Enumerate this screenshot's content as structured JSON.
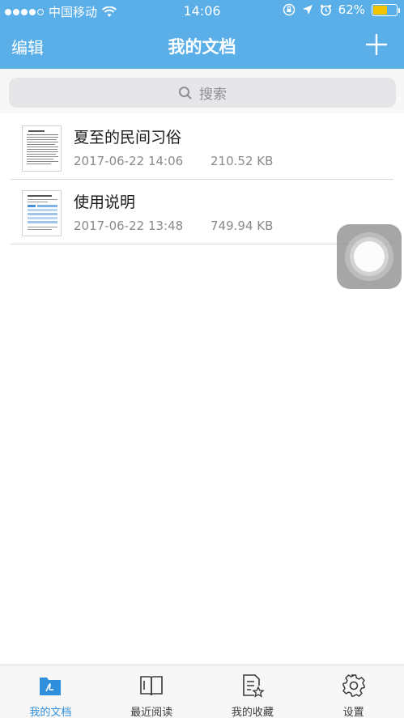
{
  "status_bar": {
    "carrier": "中国移动",
    "time": "14:06",
    "battery": "62%",
    "battery_level": 0.62,
    "signal_bars": 4
  },
  "nav": {
    "edit_label": "编辑",
    "title": "我的文档",
    "add_icon": "plus-icon"
  },
  "search": {
    "placeholder": "搜索"
  },
  "files": [
    {
      "title": "夏至的民间习俗",
      "date": "2017-06-22 14:06",
      "size": "210.52 KB"
    },
    {
      "title": "使用说明",
      "date": "2017-06-22 13:48",
      "size": "749.94 KB"
    }
  ],
  "tabs": [
    {
      "label": "我的文档",
      "icon": "pdf-folder-icon",
      "active": true
    },
    {
      "label": "最近阅读",
      "icon": "book-icon",
      "active": false
    },
    {
      "label": "我的收藏",
      "icon": "favorite-doc-icon",
      "active": false
    },
    {
      "label": "设置",
      "icon": "gear-icon",
      "active": false
    }
  ],
  "colors": {
    "accent": "#5aafe9",
    "active_tab": "#2f8fdc",
    "battery_fill": "#f5c400"
  }
}
